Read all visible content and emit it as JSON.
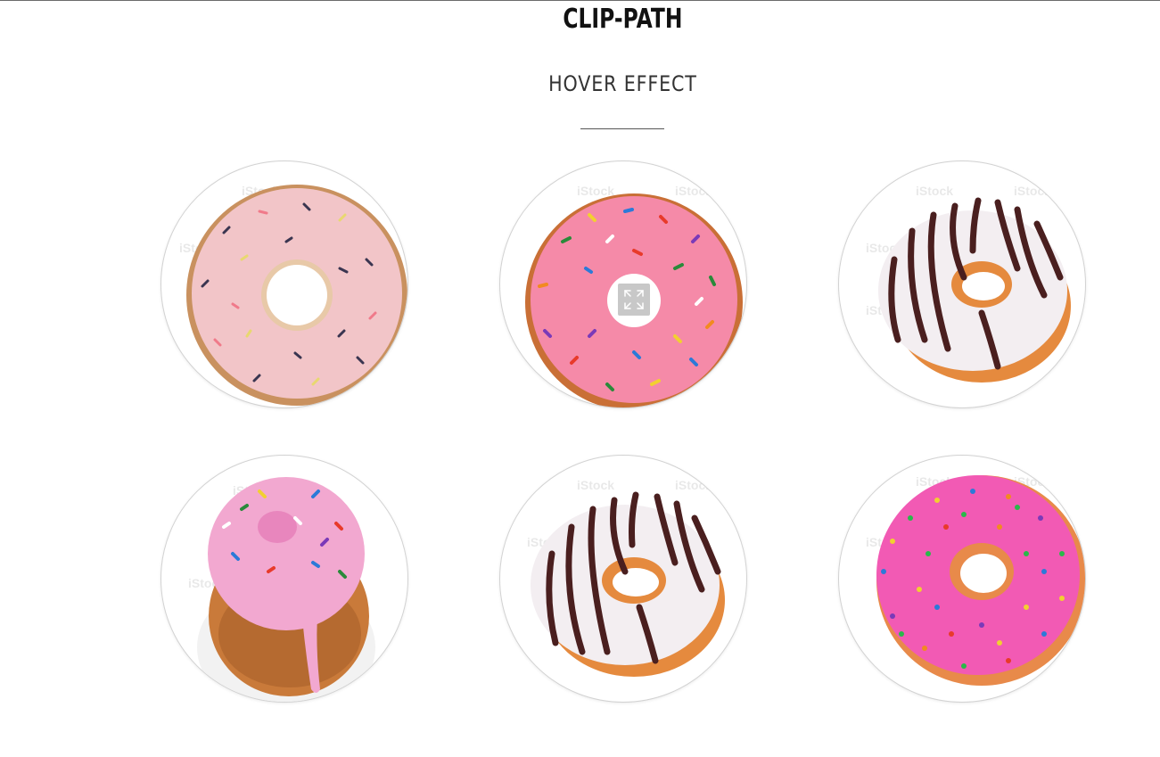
{
  "header": {
    "title": "CLIP-PATH",
    "subtitle": "HOVER EFFECT"
  },
  "gallery": {
    "watermark": "iStock",
    "watermark_sub": "by Getty Images",
    "items": [
      {
        "name": "donut-light-pink-sprinkles",
        "icon": "donut-image"
      },
      {
        "name": "donut-pink-sprinkles",
        "icon": "donut-image"
      },
      {
        "name": "donut-chocolate-drizzle",
        "icon": "donut-image"
      },
      {
        "name": "donut-pink-dripping",
        "icon": "donut-image"
      },
      {
        "name": "donut-chocolate-drizzle-2",
        "icon": "donut-image"
      },
      {
        "name": "donut-hot-pink-sprinkles",
        "icon": "donut-image"
      }
    ]
  },
  "overlay": {
    "icon": "expand-icon"
  },
  "colors": {
    "light_pink_glaze": "#f2c5c8",
    "pink_glaze": "#f58aa8",
    "white_glaze": "#f3eef1",
    "chocolate": "#4a1f1f",
    "hot_pink_glaze": "#f25ab4",
    "dough": "#d89a5a"
  }
}
